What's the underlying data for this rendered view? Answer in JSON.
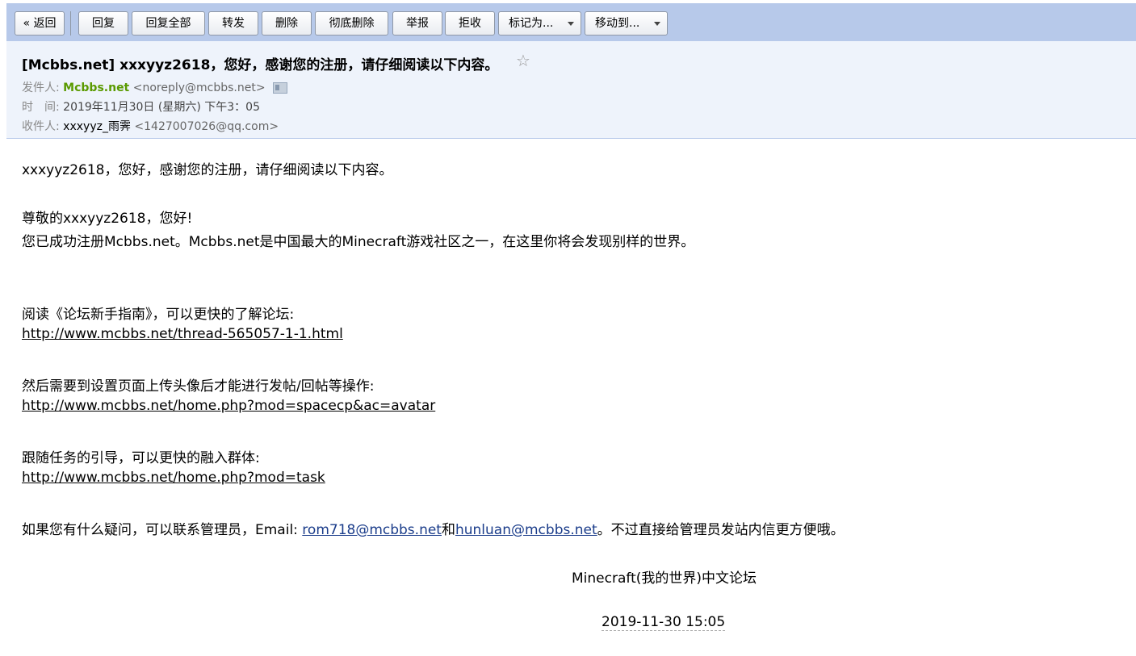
{
  "toolbar": {
    "back": "« 返回",
    "reply": "回复",
    "reply_all": "回复全部",
    "forward": "转发",
    "delete": "删除",
    "delete_forever": "彻底删除",
    "report": "举报",
    "reject": "拒收",
    "mark_as": "标记为...",
    "move_to": "移动到..."
  },
  "header": {
    "subject": "[Mcbbs.net] xxxyyz2618，您好，感谢您的注册，请仔细阅读以下内容。",
    "star": "☆",
    "from_label": "发件人:",
    "from_name": "Mcbbs.net",
    "from_addr": "<noreply@mcbbs.net>",
    "time_label": "时　间:",
    "time_value": "2019年11月30日 (星期六) 下午3：05",
    "to_label": "收件人:",
    "to_name": "xxxyyz_雨霁",
    "to_addr": "<1427007026@qq.com>"
  },
  "body": {
    "intro": "xxxyyz2618，您好，感谢您的注册，请仔细阅读以下内容。",
    "greeting": "尊敬的xxxyyz2618，您好!",
    "welcome": "您已成功注册Mcbbs.net。Mcbbs.net是中国最大的Minecraft游戏社区之一，在这里你将会发现别样的世界。",
    "guide_text": "阅读《论坛新手指南》，可以更快的了解论坛:",
    "guide_link": "http://www.mcbbs.net/thread-565057-1-1.html",
    "avatar_text": "然后需要到设置页面上传头像后才能进行发帖/回帖等操作:",
    "avatar_link": "http://www.mcbbs.net/home.php?mod=spacecp&ac=avatar",
    "task_text": "跟随任务的引导，可以更快的融入群体:",
    "task_link": "http://www.mcbbs.net/home.php?mod=task",
    "contact_prefix": "如果您有什么疑问，可以联系管理员，Email: ",
    "contact_email1": "rom718@mcbbs.net",
    "contact_and": "和",
    "contact_email2": "hunluan@mcbbs.net",
    "contact_suffix": "。不过直接给管理员发站内信更方便哦。",
    "signature": "Minecraft(我的世界)中文论坛",
    "sig_date": "2019-11-30 15:05"
  }
}
